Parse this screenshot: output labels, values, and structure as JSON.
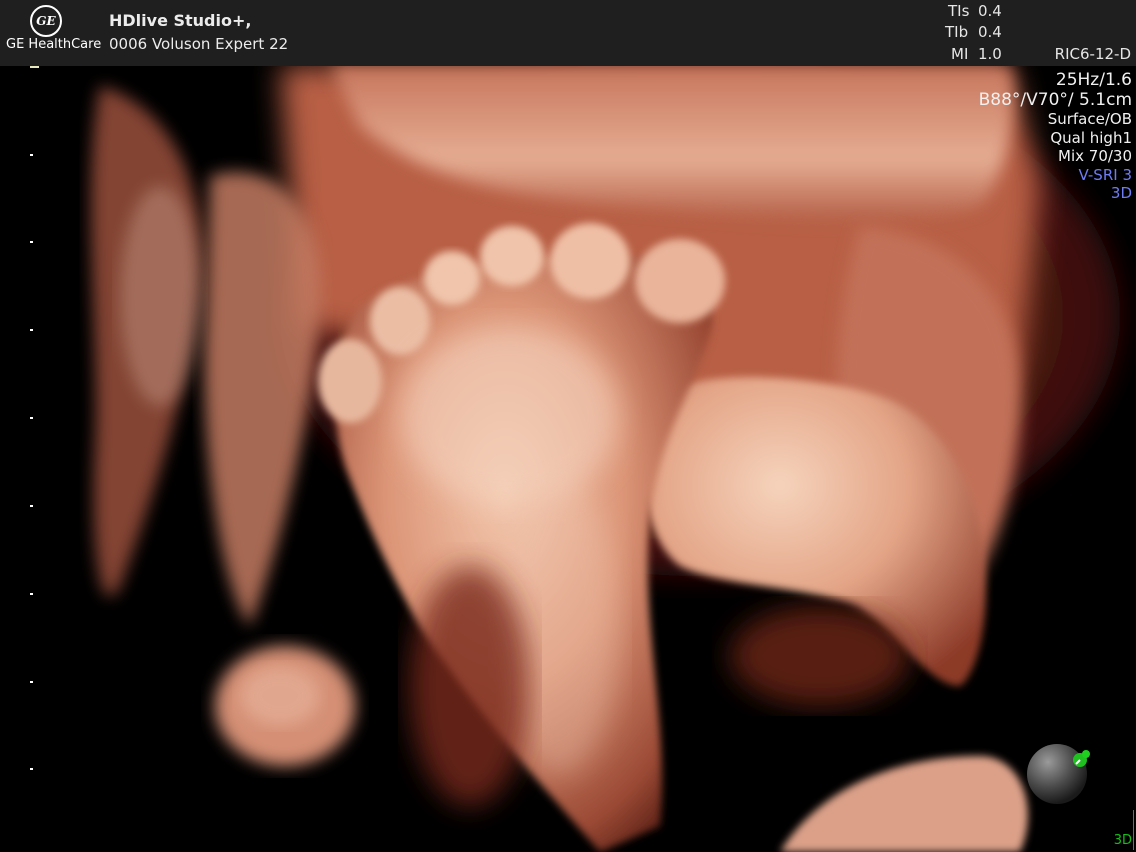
{
  "header": {
    "logo_text": "GE",
    "brand": "GE HealthCare",
    "studio": "HDlive Studio+,",
    "device": "0006 Voluson Expert 22"
  },
  "indices": [
    {
      "label": "TIs",
      "value": "0.4"
    },
    {
      "label": "TIb",
      "value": "0.4"
    },
    {
      "label": "MI",
      "value": "1.0"
    }
  ],
  "probe": "RIC6-12-D",
  "params": {
    "frame_rate": "25Hz/1.6",
    "angles": "B88°/V70°/ 5.1cm",
    "render_mode": "Surface/OB",
    "quality": "Qual high1",
    "mix": "Mix 70/30",
    "sri": "V-SRI 3",
    "mode": "3D"
  },
  "footer": {
    "mode": "3D"
  },
  "colors": {
    "topbar": "#1f1f1f",
    "accent_blue": "#6f7df5",
    "indicator_green": "#16c016"
  }
}
